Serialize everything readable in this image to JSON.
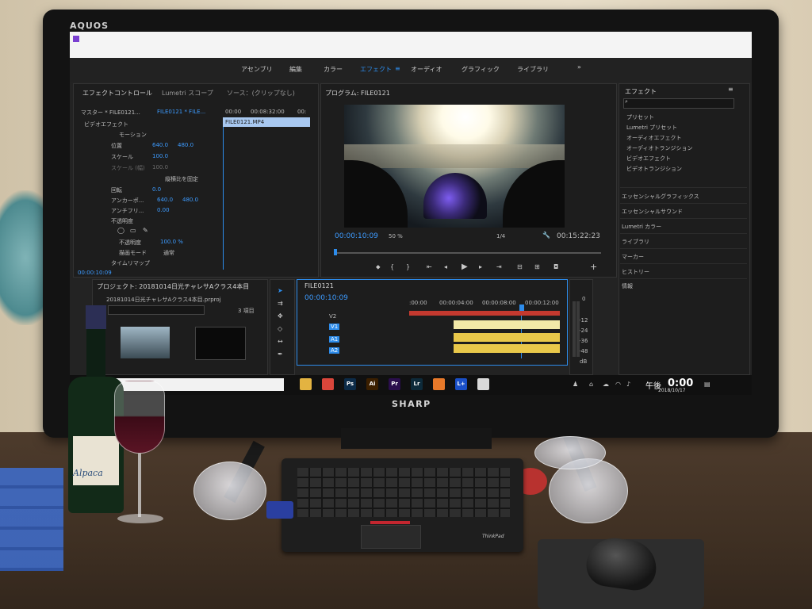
{
  "monitor": {
    "brand_top": "AQUOS",
    "brand_bottom": "SHARP"
  },
  "workspaces": [
    {
      "label": "アセンブリ"
    },
    {
      "label": "編集"
    },
    {
      "label": "カラー"
    },
    {
      "label": "エフェクト",
      "active": true
    },
    {
      "label": "オーディオ"
    },
    {
      "label": "グラフィック"
    },
    {
      "label": "ライブラリ"
    }
  ],
  "effect_controls": {
    "tabs": [
      "エフェクトコントロール",
      "Lumetri スコープ",
      "ソース：(クリップなし)"
    ],
    "master": "マスター * FILE0121...",
    "clip": "FILE0121 * FILE...",
    "timecodes": [
      "00:00",
      "00:08:32:00",
      "00:"
    ],
    "clip_bar": "FILE0121.MP4",
    "section": "ビデオエフェクト",
    "rows": [
      {
        "label": "モーション"
      },
      {
        "label": "位置",
        "values": [
          "640.0",
          "480.0"
        ]
      },
      {
        "label": "スケール",
        "values": [
          "100.0"
        ]
      },
      {
        "label": "スケール (幅)",
        "values": [
          "100.0"
        ]
      },
      {
        "label": "縦横比を固定"
      },
      {
        "label": "回転",
        "values": [
          "0.0"
        ]
      },
      {
        "label": "アンカーポ...",
        "values": [
          "640.0",
          "480.0"
        ]
      },
      {
        "label": "アンチフリ...",
        "values": [
          "0.00"
        ]
      },
      {
        "label": "不透明度"
      },
      {
        "label": "不透明度",
        "values": [
          "100.0 %"
        ]
      },
      {
        "label": "描画モード",
        "values": [
          "通常"
        ]
      },
      {
        "label": "タイムリマップ"
      }
    ],
    "footer_timecode": "00:00:10:09"
  },
  "program": {
    "title": "プログラム: FILE0121",
    "timecode": "00:00:10:09",
    "zoom": "50 %",
    "quality": "1/4",
    "duration": "00:15:22:23"
  },
  "effects_panel": {
    "title": "エフェクト",
    "folders": [
      "プリセット",
      "Lumetri プリセット",
      "オーディオエフェクト",
      "オーディオトランジション",
      "ビデオエフェクト",
      "ビデオトランジション"
    ],
    "sections": [
      "エッセンシャルグラフィックス",
      "エッセンシャルサウンド",
      "Lumetri カラー",
      "ライブラリ",
      "マーカー",
      "ヒストリー",
      "情報"
    ]
  },
  "project": {
    "title": "プロジェクト: 20181014日光チャレサAクラス4本目",
    "file": "20181014日光チャレサAクラス4本目.prproj",
    "count": "3 項目"
  },
  "timeline": {
    "title": "FILE0121",
    "timecode": "00:00:10:09",
    "ruler": [
      ":00:00",
      "00:00:04:00",
      "00:00:08:00",
      "00:00:12:00"
    ],
    "tracks": [
      "V2",
      "V1",
      "A1",
      "A2"
    ],
    "meter": [
      "0",
      "-12",
      "-24",
      "-36",
      "-48",
      "dB"
    ]
  },
  "taskbar": {
    "apps": [
      {
        "name": "explorer",
        "color": "#e3b341",
        "glyph": ""
      },
      {
        "name": "chrome",
        "color": "#d9463b",
        "glyph": ""
      },
      {
        "name": "photoshop",
        "color": "#0c2b48",
        "glyph": "Ps"
      },
      {
        "name": "illustrator",
        "color": "#3b1f00",
        "glyph": "Ai"
      },
      {
        "name": "premiere",
        "color": "#2a0e4d",
        "glyph": "Pr"
      },
      {
        "name": "lightroom",
        "color": "#0d2a3a",
        "glyph": "Lr"
      },
      {
        "name": "orange-app",
        "color": "#e8792a",
        "glyph": ""
      },
      {
        "name": "blue-app",
        "color": "#1a4fc7",
        "glyph": "L+"
      },
      {
        "name": "white-app",
        "color": "#d9d9d9",
        "glyph": ""
      }
    ],
    "clock": "0:00",
    "ampm": "午後",
    "date": "2018/10/17"
  },
  "laptop": {
    "brand": "ThinkPad"
  },
  "wine": {
    "label": "Alpaca"
  }
}
